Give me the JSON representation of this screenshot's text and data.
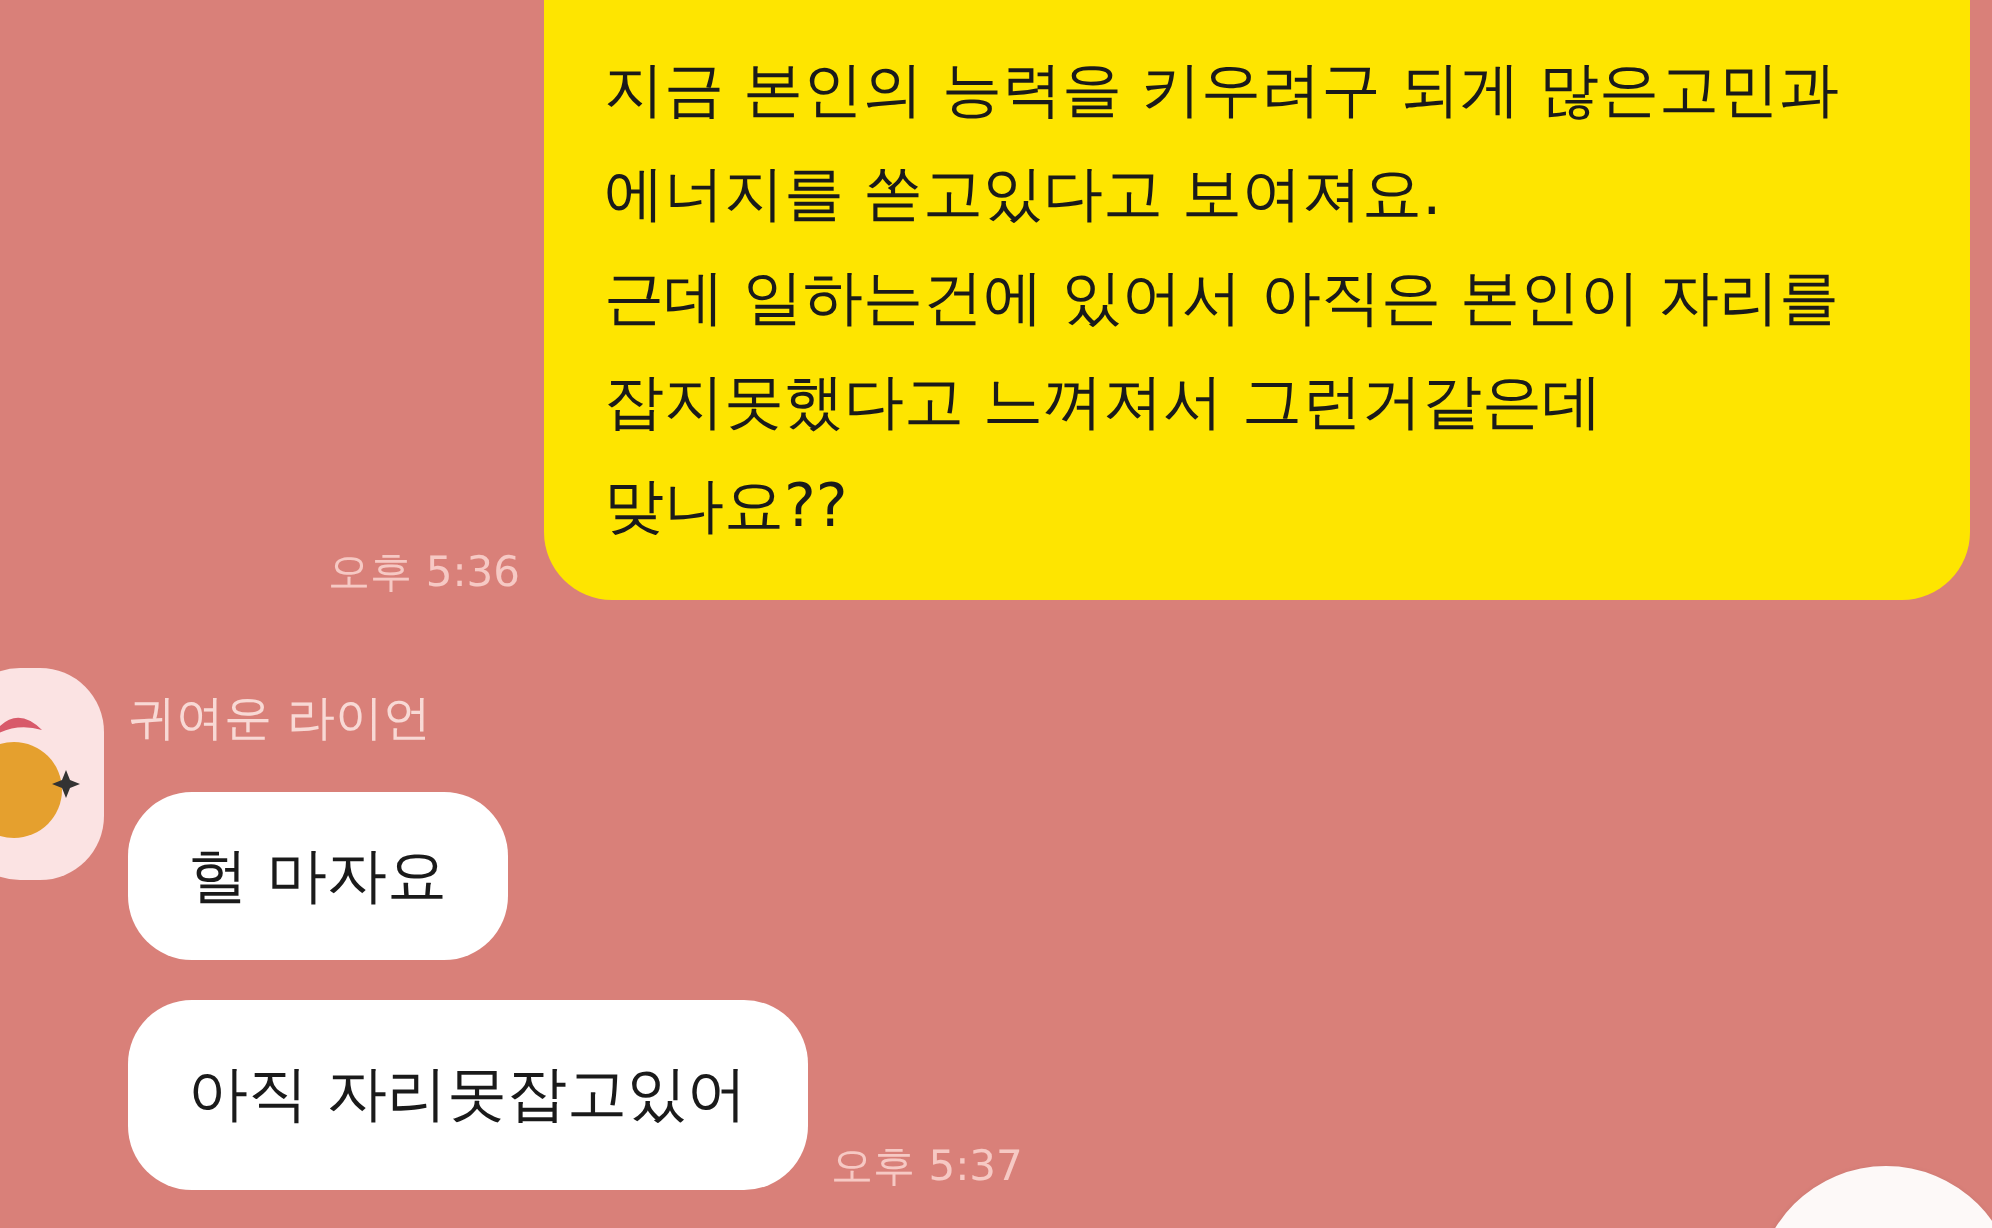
{
  "messages": [
    {
      "kind": "outgoing",
      "lines": [
        "지금 본인의 능력을 키우려구 되게 많은고민과",
        "에너지를 쏟고있다고 보여져요.",
        "근데 일하는건에 있어서 아직은 본인이 자리를",
        "잡지못했다고 느껴져서 그런거같은데",
        "맞나요??"
      ],
      "time": "오후 5:36"
    },
    {
      "kind": "incoming",
      "sender": "귀여운 라이언",
      "bubbles": [
        "헐 마자요",
        "아직 자리못잡고있어"
      ],
      "time": "오후 5:37"
    }
  ]
}
